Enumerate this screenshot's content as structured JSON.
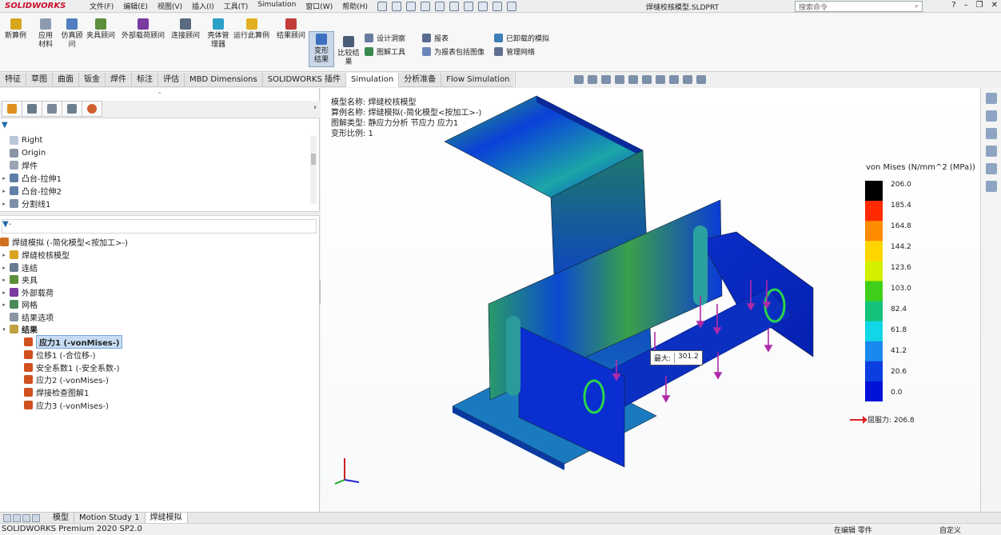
{
  "app": {
    "logo": "SOLIDWORKS",
    "doc_title": "焊缝校核模型.SLDPRT"
  },
  "menus": [
    "文件(F)",
    "编辑(E)",
    "视图(V)",
    "插入(I)",
    "工具(T)",
    "Simulation",
    "窗口(W)",
    "帮助(H)"
  ],
  "search": {
    "placeholder": "搜索命令"
  },
  "window_controls": {
    "help": "?",
    "minimize": "–",
    "restore": "❐",
    "close": "✕"
  },
  "ribbon": {
    "new_study": "新算例",
    "apply_material": "应用材料",
    "sim_advisor": "仿真顾问",
    "fixtures_advisor": "夹具顾问",
    "loads_advisor": "外部载荷顾问",
    "connections_advisor": "连接顾问",
    "shell_manager": "壳体管理器",
    "run_study": "运行此算例",
    "results_advisor": "结果顾问",
    "deformed_result": "变形结果",
    "compare_results": "比较结果",
    "design_insight": "设计洞察",
    "plot_tools": "图解工具",
    "report": "报表",
    "include_image": "为报表包括图像",
    "offloaded": "已卸载的模拟",
    "manage_network": "管理网络"
  },
  "tabs": [
    "特征",
    "草图",
    "曲面",
    "钣金",
    "焊件",
    "标注",
    "评估",
    "MBD Dimensions",
    "SOLIDWORKS 插件",
    "Simulation",
    "分析准备",
    "Flow Simulation"
  ],
  "active_tab": "Simulation",
  "feature_tree": [
    {
      "label": "Right",
      "expand": ""
    },
    {
      "label": "Origin",
      "expand": ""
    },
    {
      "label": "焊件",
      "expand": ""
    },
    {
      "label": "凸台-拉伸1",
      "expand": "▸"
    },
    {
      "label": "凸台-拉伸2",
      "expand": "▸"
    },
    {
      "label": "分割线1",
      "expand": "▸"
    }
  ],
  "study_tree": {
    "root": "焊缝模拟 (-简化模型<按加工>-)",
    "items": [
      {
        "label": "焊缝校核模型",
        "expand": "▸"
      },
      {
        "label": "连结",
        "expand": "▸"
      },
      {
        "label": "夹具",
        "expand": "▸"
      },
      {
        "label": "外部载荷",
        "expand": "▸"
      },
      {
        "label": "网格",
        "expand": "▸"
      },
      {
        "label": "结果选项",
        "expand": ""
      },
      {
        "label": "结果",
        "expand": "▾"
      }
    ],
    "results": [
      {
        "label": "应力1 (-vonMises-)",
        "selected": true
      },
      {
        "label": "位移1 (-合位移-)",
        "selected": false
      },
      {
        "label": "安全系数1 (-安全系数-)",
        "selected": false
      },
      {
        "label": "应力2 (-vonMises-)",
        "selected": false
      },
      {
        "label": "焊接检查图解1",
        "selected": false
      },
      {
        "label": "应力3 (-vonMises-)",
        "selected": false
      }
    ]
  },
  "plot_info": {
    "model_name": "模型名称: 焊缝校核模型",
    "study_name": "算例名称: 焊缝模拟(-简化模型<按加工>-)",
    "plot_type": "图解类型: 静应力分析 节应力 应力1",
    "deformation_scale": "变形比例: 1"
  },
  "legend": {
    "title": "von Mises (N/mm^2 (MPa))",
    "values": [
      "206.0",
      "185.4",
      "164.8",
      "144.2",
      "123.6",
      "103.0",
      "82.4",
      "61.8",
      "41.2",
      "20.6",
      "0.0"
    ],
    "colors": [
      "#000000",
      "#ff2a00",
      "#ff8c00",
      "#ffd500",
      "#d4f000",
      "#3fcf1a",
      "#14c27a",
      "#11d6e8",
      "#1a88ee",
      "#0a3ee0",
      "#0012d8"
    ],
    "yield_label": "屈服力: 206.8"
  },
  "probe": {
    "label": "最大:",
    "value": "301.2"
  },
  "bottom_tabs": [
    "模型",
    "Motion Study 1",
    "焊缝模拟"
  ],
  "active_bottom_tab": "焊缝模拟",
  "status": {
    "product": "SOLIDWORKS Premium 2020 SP2.0",
    "editing": "在编辑 零件",
    "custom": "自定义"
  }
}
